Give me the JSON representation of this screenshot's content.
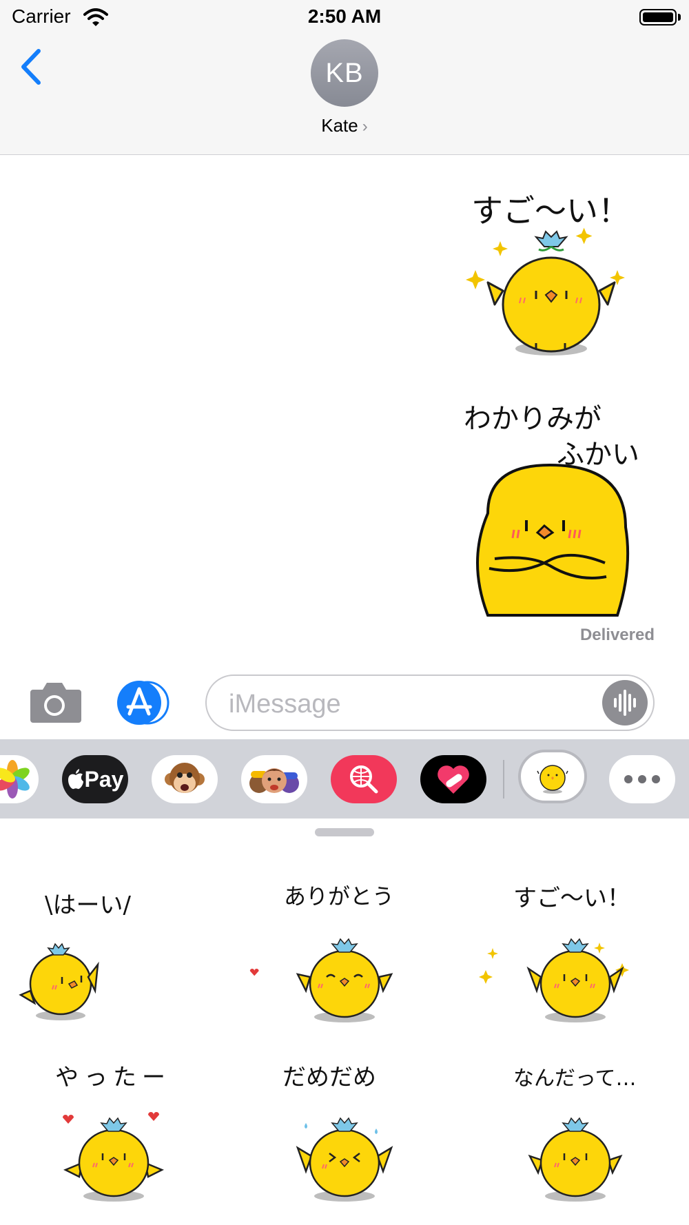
{
  "status": {
    "carrier": "Carrier",
    "time": "2:50 AM"
  },
  "header": {
    "initials": "KB",
    "contact_name": "Kate",
    "contact_chevron": "›"
  },
  "messages": {
    "sticker1_text": "すご〜い！",
    "sticker2_line1": "わかりみが",
    "sticker2_line2": "ふかい",
    "delivered": "Delivered"
  },
  "input": {
    "placeholder": "iMessage"
  },
  "apps": {
    "pay_label": "Pay"
  },
  "stickers": [
    {
      "caption": "\\はーい/"
    },
    {
      "caption": "ありがとう"
    },
    {
      "caption": "すご〜い！"
    },
    {
      "caption": "やったー"
    },
    {
      "caption": "だめだめ"
    },
    {
      "caption": "なんだって…"
    }
  ],
  "colors": {
    "accent": "#147efb",
    "chick": "#fdd60a",
    "drawer": "#d1d3d9"
  }
}
